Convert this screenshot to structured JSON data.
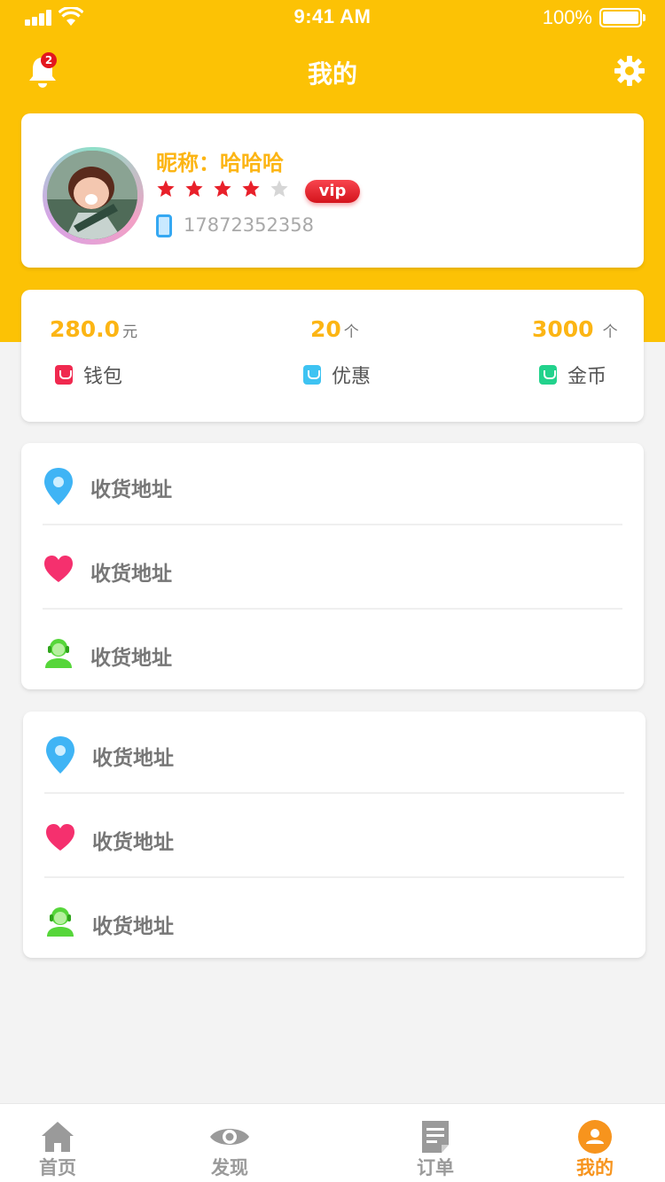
{
  "status_bar": {
    "time": "9:41 AM",
    "battery": "100%"
  },
  "nav": {
    "title": "我的",
    "notification_count": "2"
  },
  "profile": {
    "nickname": "昵称：哈哈哈",
    "rating": 4,
    "rating_max": 5,
    "vip_label": "vip",
    "phone": "17872352358"
  },
  "stats": [
    {
      "value": "280.0",
      "unit": "元",
      "label": "钱包",
      "color": "#f0294f"
    },
    {
      "value": "20",
      "unit": "个",
      "label": "优惠",
      "color": "#3ec3f2"
    },
    {
      "value": "3000",
      "unit": "个",
      "label": "金币",
      "color": "#22d28c"
    }
  ],
  "menu_group_1": [
    {
      "label": "收货地址",
      "icon": "location-pin-icon"
    },
    {
      "label": "收货地址",
      "icon": "heart-icon"
    },
    {
      "label": "收货地址",
      "icon": "customer-service-icon"
    }
  ],
  "menu_group_2": [
    {
      "label": "收货地址",
      "icon": "location-pin-icon"
    },
    {
      "label": "收货地址",
      "icon": "heart-icon"
    },
    {
      "label": "收货地址",
      "icon": "customer-service-icon"
    }
  ],
  "tabs": [
    {
      "label": "首页",
      "icon": "home-icon",
      "active": false
    },
    {
      "label": "发现",
      "icon": "eye-icon",
      "active": false
    },
    {
      "label": "订单",
      "icon": "order-icon",
      "active": false
    },
    {
      "label": "我的",
      "icon": "user-icon",
      "active": true
    }
  ],
  "colors": {
    "header": "#fcc205",
    "accent": "#fcb514",
    "active_tab": "#f7941d"
  }
}
